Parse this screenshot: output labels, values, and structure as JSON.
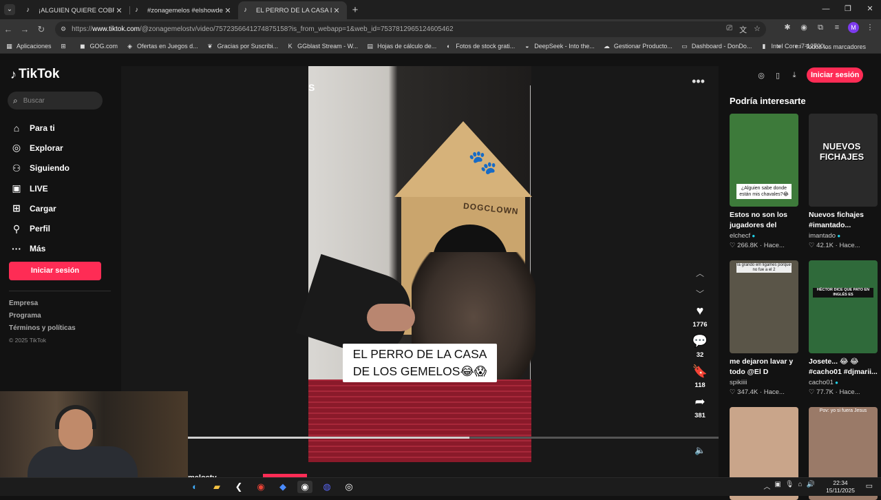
{
  "browser": {
    "tabs": [
      {
        "title": "¡ALGUIEN QUIERE COBRAR? @",
        "active": false
      },
      {
        "title": "#zonagemelos #elshowdelosge",
        "active": false
      },
      {
        "title": "EL PERRO DE LA CASA DE I",
        "active": true
      }
    ],
    "url_prefix": "https://",
    "url_host": "www.tiktok.com",
    "url_path": "/@zonagemelostv/video/7572356641274875158?is_from_webapp=1&web_id=7537812965124605462",
    "profile_initial": "M",
    "bookmarks": [
      {
        "label": "Aplicaciones",
        "icon": "apps-icon"
      },
      {
        "label": "",
        "icon": "grid-icon"
      },
      {
        "label": "GOG.com",
        "icon": "gog-icon"
      },
      {
        "label": "Ofertas en Juegos d...",
        "icon": "tag-icon"
      },
      {
        "label": "Gracias por Suscribi...",
        "icon": "leaf-icon"
      },
      {
        "label": "GGblast Stream - W...",
        "icon": "k-icon"
      },
      {
        "label": "Hojas de cálculo de...",
        "icon": "sheets-icon"
      },
      {
        "label": "Fotos de stock grati...",
        "icon": "camera-icon"
      },
      {
        "label": "DeepSeek - Into the...",
        "icon": "whale-icon"
      },
      {
        "label": "Gestionar Producto...",
        "icon": "cloud-icon"
      },
      {
        "label": "Dashboard - DonDo...",
        "icon": "folder-icon"
      },
      {
        "label": "Intel Core i7-12700...",
        "icon": "shop-icon"
      }
    ],
    "all_bookmarks": "Todos los marcadores"
  },
  "tiktok": {
    "logo": "TikTok",
    "search_placeholder": "Buscar",
    "nav": [
      {
        "label": "Para ti",
        "icon": "home-icon"
      },
      {
        "label": "Explorar",
        "icon": "compass-icon"
      },
      {
        "label": "Siguiendo",
        "icon": "following-icon"
      },
      {
        "label": "LIVE",
        "icon": "live-icon"
      },
      {
        "label": "Cargar",
        "icon": "upload-icon"
      },
      {
        "label": "Perfil",
        "icon": "profile-icon"
      },
      {
        "label": "Más",
        "icon": "more-icon"
      }
    ],
    "login_label": "Iniciar sesión",
    "footer_links": [
      "Empresa",
      "Programa",
      "Términos y políticas"
    ],
    "copyright": "© 2025 TikTok",
    "video": {
      "side_text": "S",
      "caption": "EL PERRO DE LA CASA DE LOS GEMELOS😂😱",
      "dog_house_text": "DOGCLOWN",
      "progress": 0.53,
      "handle_partial": "melostv"
    },
    "actions": [
      {
        "icon": "heart-icon",
        "count": "1776"
      },
      {
        "icon": "comment-icon",
        "count": "32"
      },
      {
        "icon": "bookmark-icon",
        "count": "118"
      },
      {
        "icon": "share-icon",
        "count": "381"
      }
    ],
    "suggestions_title": "Podría interesarte",
    "suggestions": [
      {
        "title": "Estos no son los jugadores del Elche...",
        "author": "elchecf",
        "verified": true,
        "views": "266.8K",
        "ago": "Hace...",
        "thumb_text": "¿Alguien sabe donde están mis chavales?😂",
        "thumb_color": "#3d7a3a"
      },
      {
        "title": "Nuevos fichajes #imantado...",
        "author": "imantado",
        "verified": true,
        "views": "42.1K",
        "ago": "Hace...",
        "thumb_text": "NUEVOS FICHAJES",
        "thumb_color": "#2a2a2a"
      },
      {
        "title": "me dejaron lavar y todo @El D",
        "author": "spikiiii",
        "verified": false,
        "views": "347.4K",
        "ago": "Hace...",
        "thumb_text": "la grando em ligames porque no fue a el 2",
        "thumb_color": "#5a5548"
      },
      {
        "title": "Josete... 😂 😂 #cacho01 #djmarii...",
        "author": "cacho01",
        "verified": true,
        "views": "77.7K",
        "ago": "Hace...",
        "thumb_text": "HÉCTOR DICE QUE PATO EN INGLÉS ES",
        "thumb_color": "#2f6a3a"
      },
      {
        "title": "",
        "author": "",
        "verified": false,
        "views": "",
        "ago": "",
        "thumb_text": "",
        "thumb_color": "#c9a58a"
      },
      {
        "title": "",
        "author": "",
        "verified": false,
        "views": "",
        "ago": "",
        "thumb_text": "Pov: yo si fuera Jesus",
        "thumb_color": "#9a7a68"
      }
    ]
  },
  "taskbar": {
    "time": "22:34",
    "date": "15/11/2025"
  }
}
